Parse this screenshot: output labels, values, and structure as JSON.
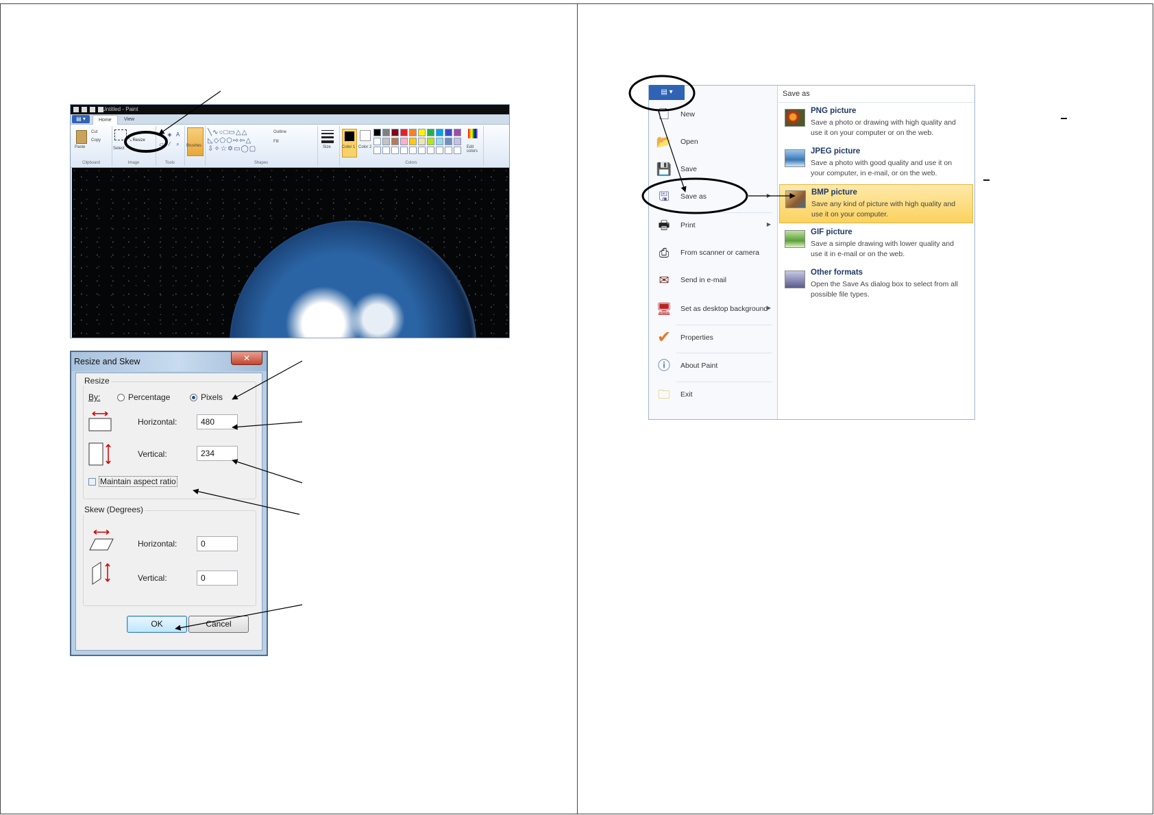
{
  "paint": {
    "window_title": "Untitled - Paint",
    "tabs": [
      "Home",
      "View"
    ],
    "groups": {
      "clipboard": "Clipboard",
      "image": "Image",
      "tools": "Tools",
      "shapes": "Shapes",
      "colors": "Colors"
    },
    "buttons": {
      "paste": "Paste",
      "cut": "Cut",
      "copy": "Copy",
      "select": "Select",
      "resize": "Resize",
      "brushes": "Brushes",
      "outline": "Outline",
      "fill": "Fill",
      "size": "Size",
      "color1": "Color 1",
      "color2": "Color 2",
      "edit_colors": "Edit colors"
    },
    "palette": [
      "#000000",
      "#7f7f7f",
      "#880015",
      "#ed1c24",
      "#ff7f27",
      "#fff200",
      "#22b14c",
      "#00a2e8",
      "#3f48cc",
      "#a349a4",
      "#ffffff",
      "#c3c3c3",
      "#b97a57",
      "#ffaec9",
      "#ffc90e",
      "#efe4b0",
      "#b5e61d",
      "#99d9ea",
      "#7092be",
      "#c8bfe7",
      "#ffffff",
      "#ffffff",
      "#ffffff",
      "#ffffff",
      "#ffffff",
      "#ffffff",
      "#ffffff",
      "#ffffff",
      "#ffffff",
      "#ffffff"
    ]
  },
  "resize_dialog": {
    "title": "Resize and Skew",
    "close_label": "✕",
    "resize_legend": "Resize",
    "by_label": "By:",
    "percentage_label": "Percentage",
    "pixels_label": "Pixels",
    "horizontal_label": "Horizontal:",
    "vertical_label": "Vertical:",
    "horizontal_value": "480",
    "vertical_value": "234",
    "maintain_label": "Maintain aspect ratio",
    "skew_legend": "Skew (Degrees)",
    "skew_horizontal_value": "0",
    "skew_vertical_value": "0",
    "ok_label": "OK",
    "cancel_label": "Cancel"
  },
  "app_menu": {
    "items": [
      {
        "label": "New",
        "icon": "new-doc-icon"
      },
      {
        "label": "Open",
        "icon": "open-folder-icon"
      },
      {
        "label": "Save",
        "icon": "save-disk-icon"
      },
      {
        "label": "Save as",
        "icon": "save-as-icon"
      },
      {
        "label": "Print",
        "icon": "printer-icon"
      },
      {
        "label": "From scanner or camera",
        "icon": "scanner-icon"
      },
      {
        "label": "Send in e-mail",
        "icon": "email-icon"
      },
      {
        "label": "Set as desktop background",
        "icon": "desktop-icon"
      },
      {
        "label": "Properties",
        "icon": "checkmark-icon"
      },
      {
        "label": "About Paint",
        "icon": "info-icon"
      },
      {
        "label": "Exit",
        "icon": "exit-icon"
      }
    ],
    "save_as_title": "Save as",
    "formats": [
      {
        "name": "PNG picture",
        "desc": "Save a photo or drawing with high quality and use it on your computer or on the web."
      },
      {
        "name": "JPEG picture",
        "desc": "Save a photo with good quality and use it on your computer, in e-mail, or on the web."
      },
      {
        "name": "BMP picture",
        "desc": "Save any kind of picture with high quality and use it on your computer."
      },
      {
        "name": "GIF picture",
        "desc": "Save a simple drawing with lower quality and use it in e-mail or on the web."
      },
      {
        "name": "Other formats",
        "desc": "Open the Save As dialog box to select from all possible file types."
      }
    ]
  },
  "colors": {
    "menu_blue": "#2f63b4",
    "highlight": "#fcd25f",
    "annotation": "#000000"
  }
}
